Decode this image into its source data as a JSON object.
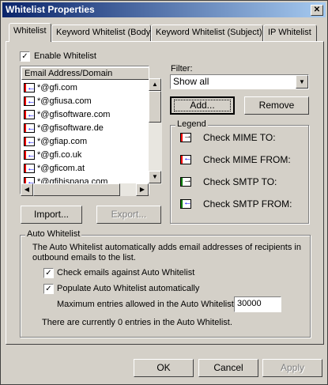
{
  "window": {
    "title": "Whitelist Properties",
    "close_glyph": "✕"
  },
  "tabs": [
    {
      "label": "Whitelist",
      "active": true
    },
    {
      "label": "Keyword Whitelist (Body)",
      "active": false
    },
    {
      "label": "Keyword Whitelist (Subject)",
      "active": false
    },
    {
      "label": "IP Whitelist",
      "active": false
    }
  ],
  "enable_whitelist": {
    "label": "Enable Whitelist",
    "checked": true
  },
  "list": {
    "column_header": "Email Address/Domain",
    "rows": [
      "*@gfi.com",
      "*@gfiusa.com",
      "*@gfisoftware.com",
      "*@gfisoftware.de",
      "*@gfiap.com",
      "*@gfi.co.uk",
      "*@gficom.at",
      "*@gfihispana.com"
    ]
  },
  "filter": {
    "label": "Filter:",
    "value": "Show all"
  },
  "buttons": {
    "add": "Add...",
    "remove": "Remove",
    "import": "Import...",
    "export": "Export...",
    "ok": "OK",
    "cancel": "Cancel",
    "apply": "Apply"
  },
  "legend": {
    "title": "Legend",
    "items": [
      {
        "label": "Check MIME TO:",
        "color": "#ff0000",
        "arrow": "right"
      },
      {
        "label": "Check MIME FROM:",
        "color": "#ff0000",
        "arrow": "left"
      },
      {
        "label": "Check SMTP TO:",
        "color": "#008000",
        "arrow": "right"
      },
      {
        "label": "Check SMTP FROM:",
        "color": "#008000",
        "arrow": "left"
      }
    ]
  },
  "auto_whitelist": {
    "title": "Auto Whitelist",
    "description": "The Auto Whitelist automatically adds email addresses of recipients in outbound emails to the list.",
    "check_emails": {
      "label": "Check emails against Auto Whitelist",
      "checked": true
    },
    "populate": {
      "label": "Populate Auto Whitelist automatically",
      "checked": true
    },
    "max_entries_label": "Maximum entries allowed in the Auto Whitelist:",
    "max_entries_value": "30000",
    "status": "There are currently 0 entries in the Auto Whitelist."
  },
  "colors": {
    "title_start": "#0a246a",
    "title_end": "#a6caf0",
    "face": "#d4d0c8",
    "arrow_blue": "#0000ff"
  }
}
